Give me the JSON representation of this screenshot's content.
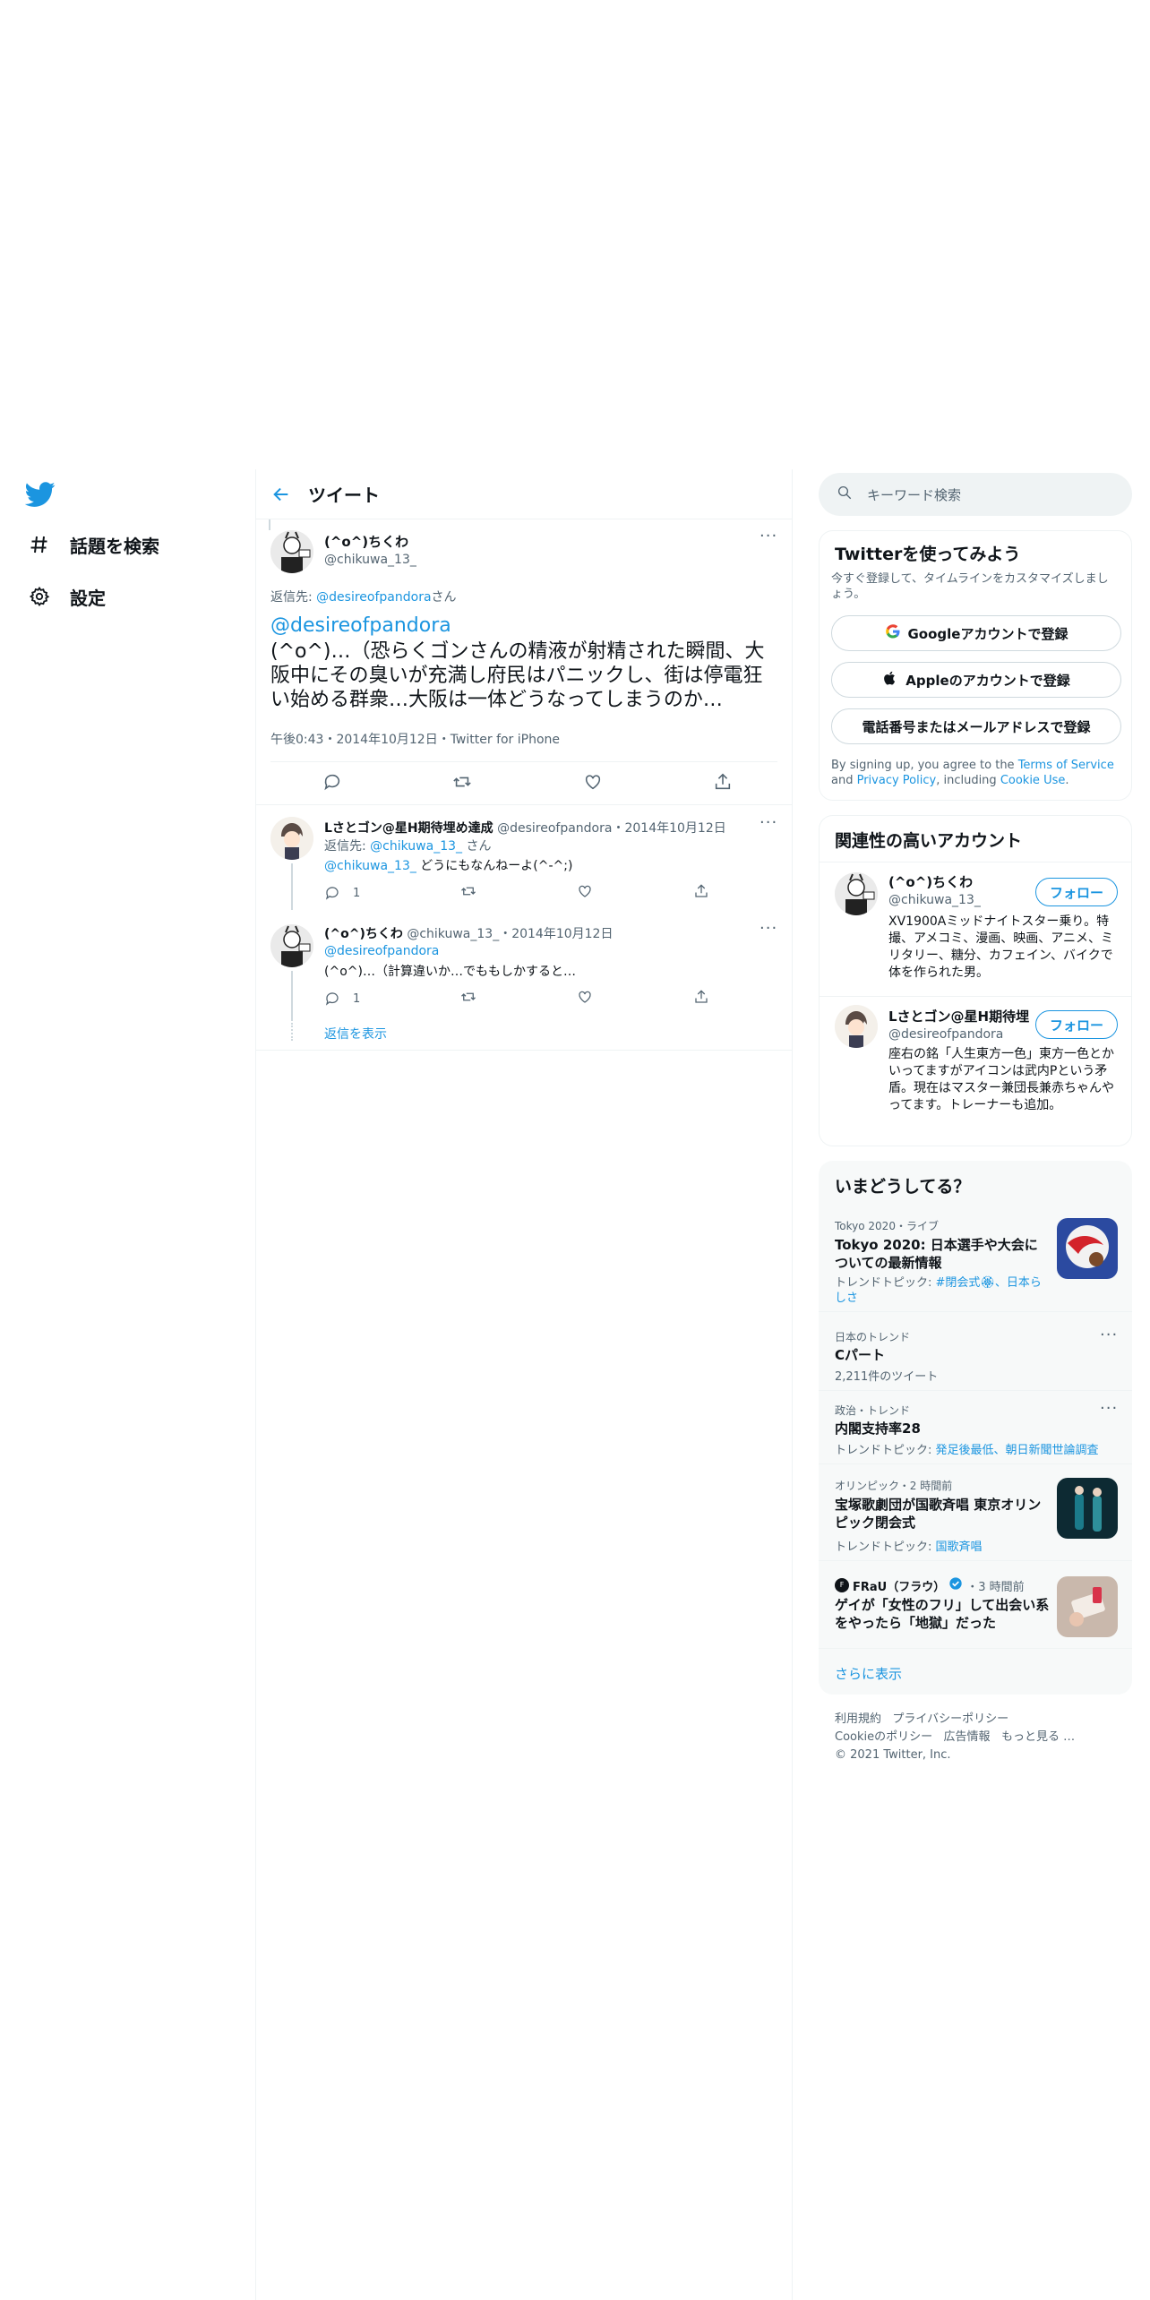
{
  "colors": {
    "accent": "#1b95e0",
    "text": "#0f1419",
    "muted": "#536471",
    "border": "#eff3f4",
    "panel": "#f7f9f9"
  },
  "nav": {
    "items": [
      {
        "label": "話題を検索",
        "icon": "hashtag-icon"
      },
      {
        "label": "設定",
        "icon": "gear-icon"
      }
    ]
  },
  "header": {
    "title": "ツイート"
  },
  "main_tweet": {
    "display_name": "(^o^)ちくわ",
    "handle": "@chikuwa_13_",
    "reply_prefix": "返信先: ",
    "reply_to": "@desireofpandora",
    "reply_suffix": "さん",
    "mention": "@desireofpandora",
    "text": "(^o^)…（恐らくゴンさんの精液が射精された瞬間、大阪中にその臭いが充満し府民はパニックし、街は停電狂い始める群衆…大阪は一体どうなってしまうのか…",
    "meta": "午後0:43・2014年10月12日・Twitter for iPhone"
  },
  "replies": [
    {
      "display_name": "Lさとゴン@星H期待埋め達成",
      "handle": "@desireofpandora",
      "date": "・2014年10月12日",
      "reply_prefix": "返信先: ",
      "reply_to": "@chikuwa_13_",
      "reply_suffix": " さん",
      "mention": "@chikuwa_13_",
      "text": " どうにもなんねーよ(^-^;)",
      "reply_count": "1"
    },
    {
      "display_name": "(^o^)ちくわ",
      "handle": "@chikuwa_13_",
      "date": "・2014年10月12日",
      "mention": "@desireofpandora",
      "text": "(^o^)…（計算違いか…でももしかすると…",
      "reply_count": "1"
    }
  ],
  "show_replies": "返信を表示",
  "search": {
    "placeholder": "キーワード検索"
  },
  "signup": {
    "title": "Twitterを使ってみよう",
    "subtitle": "今すぐ登録して、タイムラインをカスタマイズしましょう。",
    "google": "Googleアカウントで登録",
    "apple": "Appleのアカウントで登録",
    "phone": "電話番号またはメールアドレスで登録",
    "legal_1": "By signing up, you agree to the ",
    "terms": "Terms of Service",
    "legal_2": " and ",
    "privacy": "Privacy Policy",
    "legal_3": ", including ",
    "cookie": "Cookie Use",
    "legal_4": "."
  },
  "related": {
    "title": "関連性の高いアカウント",
    "accounts": [
      {
        "display_name": "(^o^)ちくわ",
        "handle": "@chikuwa_13_",
        "bio": "XV1900Aミッドナイトスター乗り。特撮、アメコミ、漫画、映画、アニメ、ミリタリー、糖分、カフェイン、バイクで体を作られた男。",
        "follow": "フォロー"
      },
      {
        "display_name": "Lさとゴン@星H期待埋",
        "handle": "@desireofpandora",
        "bio": "座右の銘「人生東方一色」東方一色とかいってますがアイコンは武内Pという矛盾。現在はマスター兼団長兼赤ちゃんやってます。トレーナーも追加。",
        "follow": "フォロー"
      }
    ]
  },
  "trends": {
    "title": "いまどうしてる？",
    "items": [
      {
        "context": "Tokyo 2020・ライブ",
        "name": "Tokyo 2020: 日本選手や大会についての最新情報",
        "sub_prefix": "トレンドトピック: ",
        "sub_links": "#閉会式🏵、日本らしさ"
      },
      {
        "context": "日本のトレンド",
        "name": "Cパート",
        "sub": "2,211件のツイート"
      },
      {
        "context": "政治・トレンド",
        "name": "内閣支持率28",
        "sub_prefix": "トレンドトピック: ",
        "sub_links": "発足後最低、朝日新聞世論調査"
      },
      {
        "context": "オリンピック・2 時間前",
        "name": "宝塚歌劇団が国歌斉唱 東京オリンピック閉会式",
        "sub_prefix": "トレンドトピック: ",
        "sub_links": "国歌斉唱"
      },
      {
        "source": "FRaU（フラウ）",
        "context": "・3 時間前",
        "name": "ゲイが「女性のフリ」して出会い系をやったら「地獄」だった"
      }
    ],
    "show_more": "さらに表示"
  },
  "footer": {
    "links_row1": [
      "利用規約",
      "プライバシーポリシー"
    ],
    "links_row2": [
      "Cookieのポリシー",
      "広告情報",
      "もっと見る …"
    ],
    "copyright": "© 2021 Twitter, Inc."
  }
}
